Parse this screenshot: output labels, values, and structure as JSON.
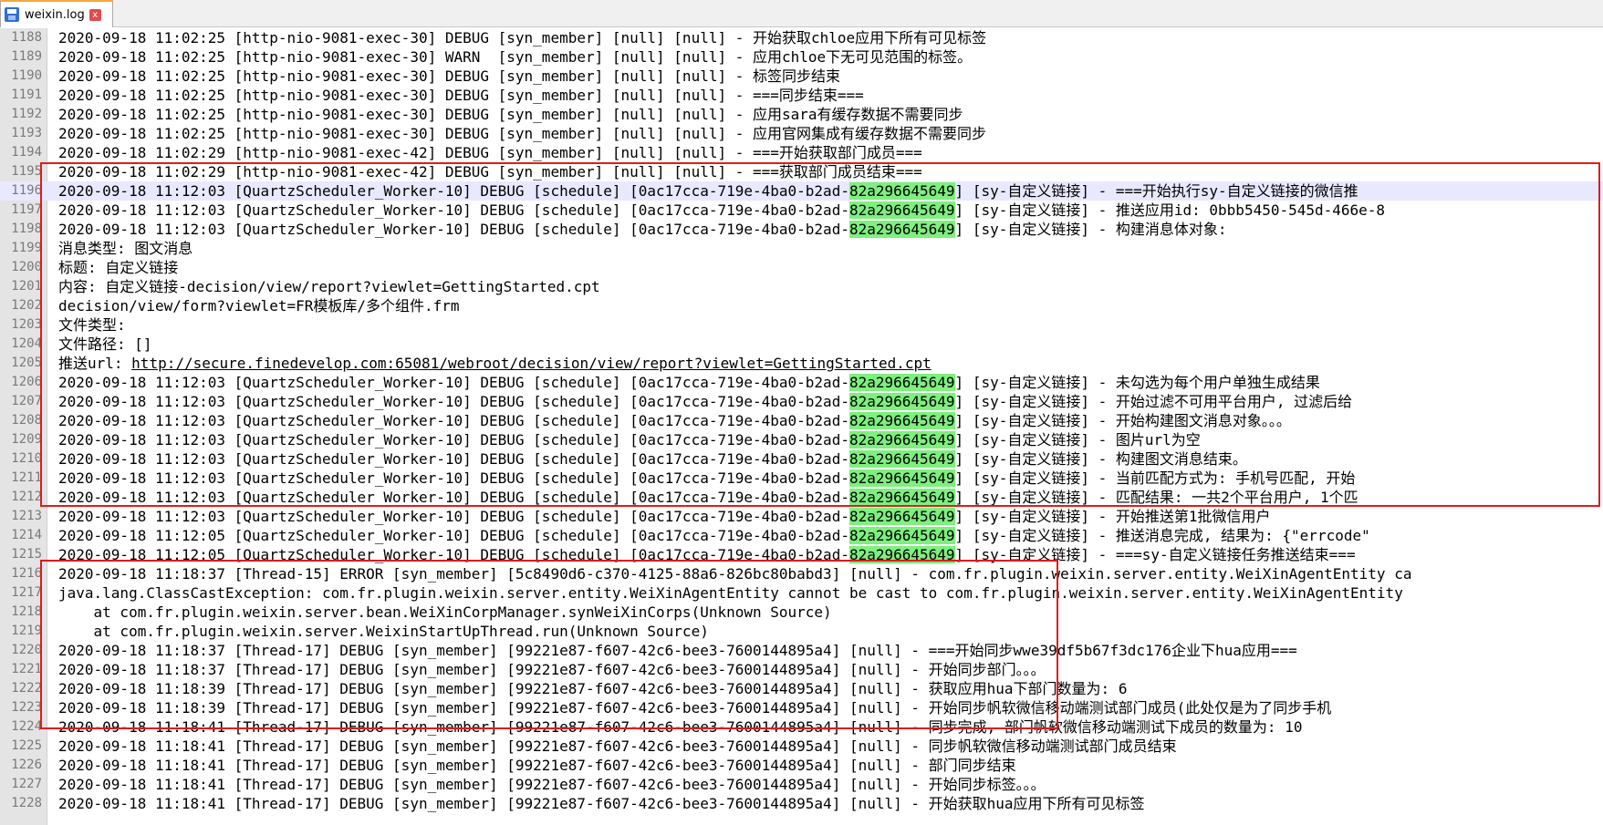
{
  "tab": {
    "filename": "weixin.log",
    "close_label": "x"
  },
  "lines": [
    {
      "n": "1188",
      "parts": [
        {
          "t": "2020-09-18 11:02:25 [http-nio-9081-exec-30] DEBUG [syn_member] [null] [null] - 开始获取chloe应用下所有可见标签"
        }
      ]
    },
    {
      "n": "1189",
      "parts": [
        {
          "t": "2020-09-18 11:02:25 [http-nio-9081-exec-30] WARN  [syn_member] [null] [null] - 应用chloe下无可见范围的标签。"
        }
      ]
    },
    {
      "n": "1190",
      "parts": [
        {
          "t": "2020-09-18 11:02:25 [http-nio-9081-exec-30] DEBUG [syn_member] [null] [null] - 标签同步结束"
        }
      ]
    },
    {
      "n": "1191",
      "parts": [
        {
          "t": "2020-09-18 11:02:25 [http-nio-9081-exec-30] DEBUG [syn_member] [null] [null] - ===同步结束==="
        }
      ]
    },
    {
      "n": "1192",
      "parts": [
        {
          "t": "2020-09-18 11:02:25 [http-nio-9081-exec-30] DEBUG [syn_member] [null] [null] - 应用sara有缓存数据不需要同步"
        }
      ]
    },
    {
      "n": "1193",
      "parts": [
        {
          "t": "2020-09-18 11:02:25 [http-nio-9081-exec-30] DEBUG [syn_member] [null] [null] - 应用官网集成有缓存数据不需要同步"
        }
      ]
    },
    {
      "n": "1194",
      "parts": [
        {
          "t": "2020-09-18 11:02:29 [http-nio-9081-exec-42] DEBUG [syn_member] [null] [null] - ===开始获取部门成员==="
        }
      ]
    },
    {
      "n": "1195",
      "parts": [
        {
          "t": "2020-09-18 11:02:29 [http-nio-9081-exec-42] DEBUG [syn_member] [null] [null] - ===获取部门成员结束==="
        }
      ]
    },
    {
      "n": "1196",
      "cur": true,
      "parts": [
        {
          "t": "2020-09-18 11:12:03 [QuartzScheduler_Worker-10] DEBUG [schedule] [0ac17cca-719e-4ba0-b2ad-"
        },
        {
          "t": "82a296645649",
          "hl": true
        },
        {
          "t": "] [sy-自定义链接] - ===开始执行sy-自定义链接的微信推"
        }
      ]
    },
    {
      "n": "1197",
      "parts": [
        {
          "t": "2020-09-18 11:12:03 [QuartzScheduler_Worker-10] DEBUG [schedule] [0ac17cca-719e-4ba0-b2ad-"
        },
        {
          "t": "82a296645649",
          "hl": true
        },
        {
          "t": "] [sy-自定义链接] - 推送应用id: 0bbb5450-545d-466e-8"
        }
      ]
    },
    {
      "n": "1198",
      "parts": [
        {
          "t": "2020-09-18 11:12:03 [QuartzScheduler_Worker-10] DEBUG [schedule] [0ac17cca-719e-4ba0-b2ad-"
        },
        {
          "t": "82a296645649",
          "hl": true
        },
        {
          "t": "] [sy-自定义链接] - 构建消息体对象:"
        }
      ]
    },
    {
      "n": "1199",
      "parts": [
        {
          "t": "消息类型: 图文消息"
        }
      ]
    },
    {
      "n": "1200",
      "parts": [
        {
          "t": "标题: 自定义链接"
        }
      ]
    },
    {
      "n": "1201",
      "parts": [
        {
          "t": "内容: 自定义链接-decision/view/report?viewlet=GettingStarted.cpt"
        }
      ]
    },
    {
      "n": "1202",
      "parts": [
        {
          "t": "decision/view/form?viewlet=FR模板库/多个组件.frm"
        }
      ]
    },
    {
      "n": "1203",
      "parts": [
        {
          "t": "文件类型:"
        }
      ]
    },
    {
      "n": "1204",
      "parts": [
        {
          "t": "文件路径: []"
        }
      ]
    },
    {
      "n": "1205",
      "parts": [
        {
          "t": "推送url: "
        },
        {
          "t": "http://secure.finedevelop.com:65081/webroot/decision/view/report?viewlet=GettingStarted.cpt",
          "url": true
        }
      ]
    },
    {
      "n": "1206",
      "parts": [
        {
          "t": "2020-09-18 11:12:03 [QuartzScheduler_Worker-10] DEBUG [schedule] [0ac17cca-719e-4ba0-b2ad-"
        },
        {
          "t": "82a296645649",
          "hl": true
        },
        {
          "t": "] [sy-自定义链接] - 未勾选为每个用户单独生成结果"
        }
      ]
    },
    {
      "n": "1207",
      "parts": [
        {
          "t": "2020-09-18 11:12:03 [QuartzScheduler_Worker-10] DEBUG [schedule] [0ac17cca-719e-4ba0-b2ad-"
        },
        {
          "t": "82a296645649",
          "hl": true
        },
        {
          "t": "] [sy-自定义链接] - 开始过滤不可用平台用户, 过滤后给"
        }
      ]
    },
    {
      "n": "1208",
      "parts": [
        {
          "t": "2020-09-18 11:12:03 [QuartzScheduler_Worker-10] DEBUG [schedule] [0ac17cca-719e-4ba0-b2ad-"
        },
        {
          "t": "82a296645649",
          "hl": true
        },
        {
          "t": "] [sy-自定义链接] - 开始构建图文消息对象。。。"
        }
      ]
    },
    {
      "n": "1209",
      "parts": [
        {
          "t": "2020-09-18 11:12:03 [QuartzScheduler_Worker-10] DEBUG [schedule] [0ac17cca-719e-4ba0-b2ad-"
        },
        {
          "t": "82a296645649",
          "hl": true
        },
        {
          "t": "] [sy-自定义链接] - 图片url为空"
        }
      ]
    },
    {
      "n": "1210",
      "parts": [
        {
          "t": "2020-09-18 11:12:03 [QuartzScheduler_Worker-10] DEBUG [schedule] [0ac17cca-719e-4ba0-b2ad-"
        },
        {
          "t": "82a296645649",
          "hl": true
        },
        {
          "t": "] [sy-自定义链接] - 构建图文消息结束。"
        }
      ]
    },
    {
      "n": "1211",
      "parts": [
        {
          "t": "2020-09-18 11:12:03 [QuartzScheduler_Worker-10] DEBUG [schedule] [0ac17cca-719e-4ba0-b2ad-"
        },
        {
          "t": "82a296645649",
          "hl": true
        },
        {
          "t": "] [sy-自定义链接] - 当前匹配方式为: 手机号匹配, 开始"
        }
      ]
    },
    {
      "n": "1212",
      "parts": [
        {
          "t": "2020-09-18 11:12:03 [QuartzScheduler_Worker-10] DEBUG [schedule] [0ac17cca-719e-4ba0-b2ad-"
        },
        {
          "t": "82a296645649",
          "hl": true
        },
        {
          "t": "] [sy-自定义链接] - 匹配结果: 一共2个平台用户, 1个匹"
        }
      ]
    },
    {
      "n": "1213",
      "parts": [
        {
          "t": "2020-09-18 11:12:03 [QuartzScheduler_Worker-10] DEBUG [schedule] [0ac17cca-719e-4ba0-b2ad-"
        },
        {
          "t": "82a296645649",
          "hl": true
        },
        {
          "t": "] [sy-自定义链接] - 开始推送第1批微信用户"
        }
      ]
    },
    {
      "n": "1214",
      "parts": [
        {
          "t": "2020-09-18 11:12:05 [QuartzScheduler_Worker-10] DEBUG [schedule] [0ac17cca-719e-4ba0-b2ad-"
        },
        {
          "t": "82a296645649",
          "hl": true
        },
        {
          "t": "] [sy-自定义链接] - 推送消息完成, 结果为: {\"errcode\""
        }
      ]
    },
    {
      "n": "1215",
      "parts": [
        {
          "t": "2020-09-18 11:12:05 [QuartzScheduler_Worker-10] DEBUG [schedule] [0ac17cca-719e-4ba0-b2ad-"
        },
        {
          "t": "82a296645649",
          "hl": true
        },
        {
          "t": "] [sy-自定义链接] - ===sy-自定义链接任务推送结束==="
        }
      ]
    },
    {
      "n": "1216",
      "parts": [
        {
          "t": "2020-09-18 11:18:37 [Thread-15] ERROR [syn_member] [5c8490d6-c370-4125-88a6-826bc80babd3] [null] - com.fr.plugin.weixin.server.entity.WeiXinAgentEntity ca"
        }
      ]
    },
    {
      "n": "1217",
      "parts": [
        {
          "t": "java.lang.ClassCastException: com.fr.plugin.weixin.server.entity.WeiXinAgentEntity cannot be cast to com.fr.plugin.weixin.server.entity.WeiXinAgentEntity"
        }
      ]
    },
    {
      "n": "1218",
      "parts": [
        {
          "t": "    at com.fr.plugin.weixin.server.bean.WeiXinCorpManager.synWeiXinCorps(Unknown Source)"
        }
      ]
    },
    {
      "n": "1219",
      "parts": [
        {
          "t": "    at com.fr.plugin.weixin.server.WeixinStartUpThread.run(Unknown Source)"
        }
      ]
    },
    {
      "n": "1220",
      "parts": [
        {
          "t": "2020-09-18 11:18:37 [Thread-17] DEBUG [syn_member] [99221e87-f607-42c6-bee3-7600144895a4] [null] - ===开始同步wwe39df5b67f3dc176企业下hua应用==="
        }
      ]
    },
    {
      "n": "1221",
      "parts": [
        {
          "t": "2020-09-18 11:18:37 [Thread-17] DEBUG [syn_member] [99221e87-f607-42c6-bee3-7600144895a4] [null] - 开始同步部门。。。"
        }
      ]
    },
    {
      "n": "1222",
      "parts": [
        {
          "t": "2020-09-18 11:18:39 [Thread-17] DEBUG [syn_member] [99221e87-f607-42c6-bee3-7600144895a4] [null] - 获取应用hua下部门数量为: 6"
        }
      ]
    },
    {
      "n": "1223",
      "parts": [
        {
          "t": "2020-09-18 11:18:39 [Thread-17] DEBUG [syn_member] [99221e87-f607-42c6-bee3-7600144895a4] [null] - 开始同步帆软微信移动端测试部门成员(此处仅是为了同步手机"
        }
      ]
    },
    {
      "n": "1224",
      "parts": [
        {
          "t": "2020-09-18 11:18:41 [Thread-17] DEBUG [syn_member] [99221e87-f607-42c6-bee3-7600144895a4] [null] - 同步完成, 部门帆软微信移动端测试下成员的数量为: 10"
        }
      ]
    },
    {
      "n": "1225",
      "parts": [
        {
          "t": "2020-09-18 11:18:41 [Thread-17] DEBUG [syn_member] [99221e87-f607-42c6-bee3-7600144895a4] [null] - 同步帆软微信移动端测试部门成员结束"
        }
      ]
    },
    {
      "n": "1226",
      "parts": [
        {
          "t": "2020-09-18 11:18:41 [Thread-17] DEBUG [syn_member] [99221e87-f607-42c6-bee3-7600144895a4] [null] - 部门同步结束"
        }
      ]
    },
    {
      "n": "1227",
      "parts": [
        {
          "t": "2020-09-18 11:18:41 [Thread-17] DEBUG [syn_member] [99221e87-f607-42c6-bee3-7600144895a4] [null] - 开始同步标签。。。"
        }
      ]
    },
    {
      "n": "1228",
      "parts": [
        {
          "t": "2020-09-18 11:18:41 [Thread-17] DEBUG [syn_member] [99221e87-f607-42c6-bee3-7600144895a4] [null] - 开始获取hua应用下所有可见标签"
        }
      ]
    }
  ]
}
